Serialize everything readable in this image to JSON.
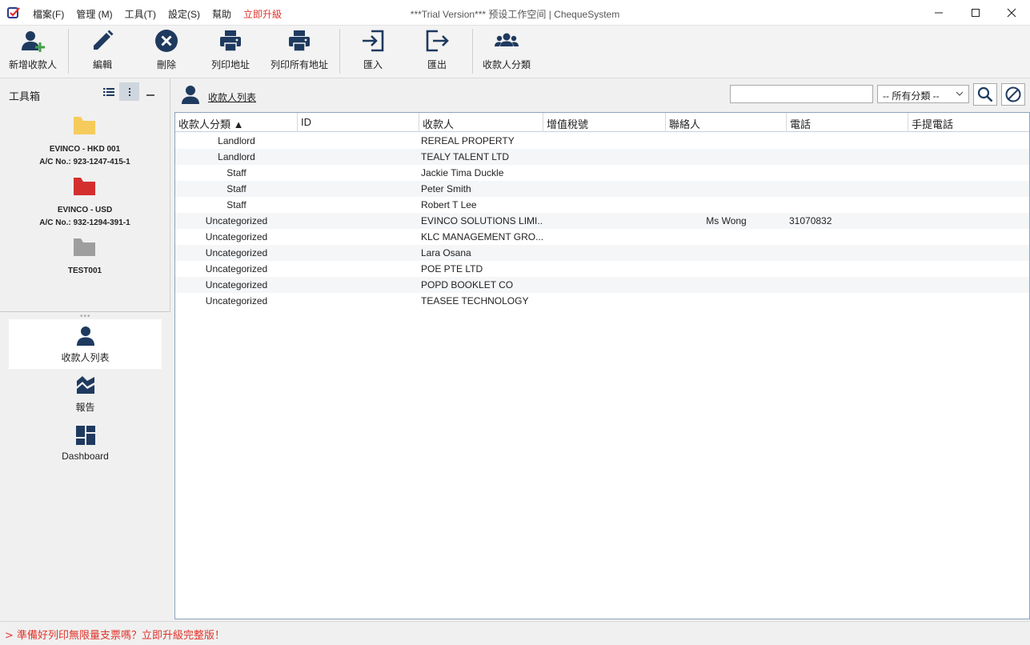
{
  "window": {
    "title": "***Trial Version*** 预设工作空间 | ChequeSystem",
    "menu": [
      "檔案(F)",
      "管理 (M)",
      "工具(T)",
      "設定(S)",
      "幫助"
    ],
    "upgrade_label": "立即升級"
  },
  "toolbar": {
    "new_payee": "新增收款人",
    "edit": "編輯",
    "delete": "刪除",
    "print_address": "列印地址",
    "print_all_addresses": "列印所有地址",
    "import": "匯入",
    "export": "匯出",
    "payee_category": "收款人分類"
  },
  "toolbox": {
    "title": "工具箱",
    "accounts": [
      {
        "name": "EVINCO - HKD 001",
        "ac": "A/C No.: 923-1247-415-1",
        "folder_color": "#f5cc5c"
      },
      {
        "name": "EVINCO - USD",
        "ac": "A/C No.: 932-1294-391-1",
        "folder_color": "#d32f2f"
      },
      {
        "name": "TEST001",
        "ac": "",
        "folder_color": "#9e9e9e"
      }
    ]
  },
  "nav": {
    "payee_list": "收款人列表",
    "report": "報告",
    "dashboard": "Dashboard"
  },
  "main": {
    "list_title": "收款人列表",
    "search_value": "",
    "filter_selected": "-- 所有分類 --",
    "columns": [
      "收款人分類 ▲",
      "ID",
      "收款人",
      "增值稅號",
      "聯絡人",
      "電話",
      "手提電話"
    ],
    "rows": [
      {
        "category": "Landlord",
        "id": "",
        "payee": "REREAL PROPERTY",
        "vat": "",
        "contact": "",
        "phone": "",
        "mobile": ""
      },
      {
        "category": "Landlord",
        "id": "",
        "payee": "TEALY TALENT LTD",
        "vat": "",
        "contact": "",
        "phone": "",
        "mobile": ""
      },
      {
        "category": "Staff",
        "id": "",
        "payee": "Jackie Tima Duckle",
        "vat": "",
        "contact": "",
        "phone": "",
        "mobile": ""
      },
      {
        "category": "Staff",
        "id": "",
        "payee": "Peter Smith",
        "vat": "",
        "contact": "",
        "phone": "",
        "mobile": ""
      },
      {
        "category": "Staff",
        "id": "",
        "payee": "Robert T Lee",
        "vat": "",
        "contact": "",
        "phone": "",
        "mobile": ""
      },
      {
        "category": "Uncategorized",
        "id": "",
        "payee": "EVINCO SOLUTIONS LIMI...",
        "vat": "",
        "contact": "Ms Wong",
        "phone": "31070832",
        "mobile": ""
      },
      {
        "category": "Uncategorized",
        "id": "",
        "payee": "KLC MANAGEMENT GRO...",
        "vat": "",
        "contact": "",
        "phone": "",
        "mobile": ""
      },
      {
        "category": "Uncategorized",
        "id": "",
        "payee": "Lara Osana",
        "vat": "",
        "contact": "",
        "phone": "",
        "mobile": ""
      },
      {
        "category": "Uncategorized",
        "id": "",
        "payee": "POE PTE LTD",
        "vat": "",
        "contact": "",
        "phone": "",
        "mobile": ""
      },
      {
        "category": "Uncategorized",
        "id": "",
        "payee": "POPD BOOKLET CO",
        "vat": "",
        "contact": "",
        "phone": "",
        "mobile": ""
      },
      {
        "category": "Uncategorized",
        "id": "",
        "payee": "TEASEE TECHNOLOGY",
        "vat": "",
        "contact": "",
        "phone": "",
        "mobile": ""
      }
    ]
  },
  "status": {
    "promo": "> 準備好列印無限量支票嗎？立即升級完整版！"
  },
  "colors": {
    "icon_navy": "#1f3a5f",
    "accent_red": "#e0342b",
    "add_green": "#43a047"
  }
}
